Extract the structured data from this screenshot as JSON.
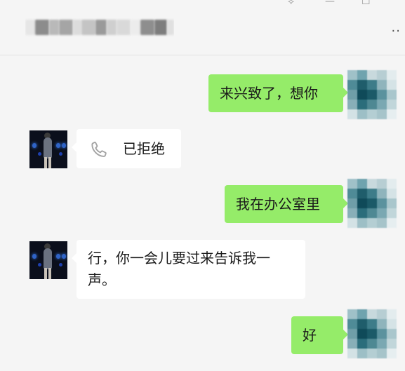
{
  "window": {
    "controls": [
      "⟡",
      "—",
      "☐"
    ],
    "more_label": "··"
  },
  "messages": [
    {
      "side": "out",
      "text": "来兴致了，想你"
    },
    {
      "side": "in",
      "type": "call",
      "icon": "phone-icon",
      "text": "已拒绝"
    },
    {
      "side": "out",
      "text": "我在办公室里"
    },
    {
      "side": "in",
      "text_line1": "行，你一会儿要过来告诉我一",
      "text_line2": "声。"
    },
    {
      "side": "out",
      "text": "好"
    }
  ],
  "colors": {
    "background": "#f5f5f5",
    "outgoing_bubble": "#95ec69",
    "incoming_bubble": "#ffffff",
    "icon_gray": "#9a9a9a"
  },
  "self_avatar_palette": [
    "#9fc1c8",
    "#6fa3ae",
    "#c8d9dd",
    "#b7ced3",
    "#e3ecee",
    "#4f8b97",
    "#1f5d6b",
    "#3d7c89",
    "#8fb4bc",
    "#d5e3e6",
    "#6f9ea8",
    "#0f4a59",
    "#1b5a68",
    "#5b929e",
    "#a9c6cc",
    "#88afb8",
    "#2b6d7b",
    "#4e8893",
    "#7aa8b2",
    "#c1d6da",
    "#d3e2e5",
    "#9dbfc6",
    "#b4ced3",
    "#a6c4ca",
    "#e6eef0"
  ]
}
